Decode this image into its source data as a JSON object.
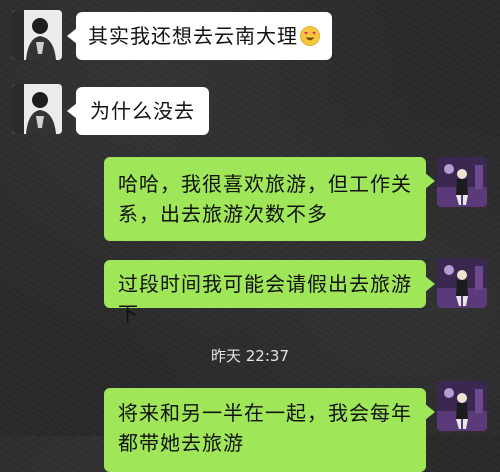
{
  "messages": [
    {
      "side": "incoming",
      "text": "其实我还想去云南大理",
      "emoji": "smiling-face-with-heart-eyes-emoji"
    },
    {
      "side": "incoming",
      "text": "为什么没去"
    },
    {
      "side": "outgoing",
      "text": "哈哈，我很喜欢旅游，但工作关系，出去旅游次数不多"
    },
    {
      "side": "outgoing",
      "text": "过段时间我可能会请假出去旅游下"
    },
    {
      "side": "outgoing",
      "text": "将来和另一半在一起，我会每年都带她去旅游"
    }
  ],
  "timestamp": "昨天 22:37",
  "colors": {
    "incoming_bubble": "#ffffff",
    "outgoing_bubble": "#9fe658",
    "background": "#2a2a2a",
    "timestamp_text": "#e6e6e6"
  },
  "icons": {
    "contact_avatar": "contact-avatar",
    "self_avatar": "self-avatar"
  }
}
